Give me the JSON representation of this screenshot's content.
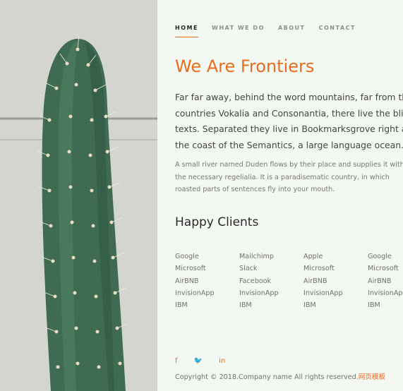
{
  "nav": {
    "items": [
      {
        "label": "HOME"
      },
      {
        "label": "WHAT WE DO"
      },
      {
        "label": "ABOUT"
      },
      {
        "label": "CONTACT"
      }
    ],
    "active": "HOME"
  },
  "hero": {
    "image": "cactus-photo"
  },
  "content": {
    "title": "We Are Frontiers",
    "lead": "Far far away, behind the word mountains, far from the countries Vokalia and Consonantia, there live the blind texts. Separated they live in Bookmarksgrove right at the coast of the Semantics, a large language ocean.",
    "body": "A small river named Duden flows by their place and supplies it with the necessary regelialia. It is a paradisematic country, in which roasted parts of sentences fly into your mouth."
  },
  "clients": {
    "heading": "Happy Clients",
    "columns": [
      [
        "Google",
        "Microsoft",
        "AirBNB",
        "InvisionApp",
        "IBM"
      ],
      [
        "Mailchimp",
        "Slack",
        "Facebook",
        "InvisionApp",
        "IBM"
      ],
      [
        "Apple",
        "Microsoft",
        "AirBNB",
        "InvisionApp",
        "IBM"
      ],
      [
        "Google",
        "Microsoft",
        "AirBNB",
        "InvisionApp",
        "IBM"
      ]
    ]
  },
  "social": [
    {
      "icon": "facebook-icon",
      "glyph": "f"
    },
    {
      "icon": "twitter-icon",
      "glyph": "🐦"
    },
    {
      "icon": "linkedin-icon",
      "glyph": "in"
    }
  ],
  "footer": {
    "copyright": "Copyright © 2018.Company name All rights reserved.",
    "link": "网页模板"
  },
  "colors": {
    "accent": "#e96b1e",
    "background": "#f4f8f2"
  }
}
